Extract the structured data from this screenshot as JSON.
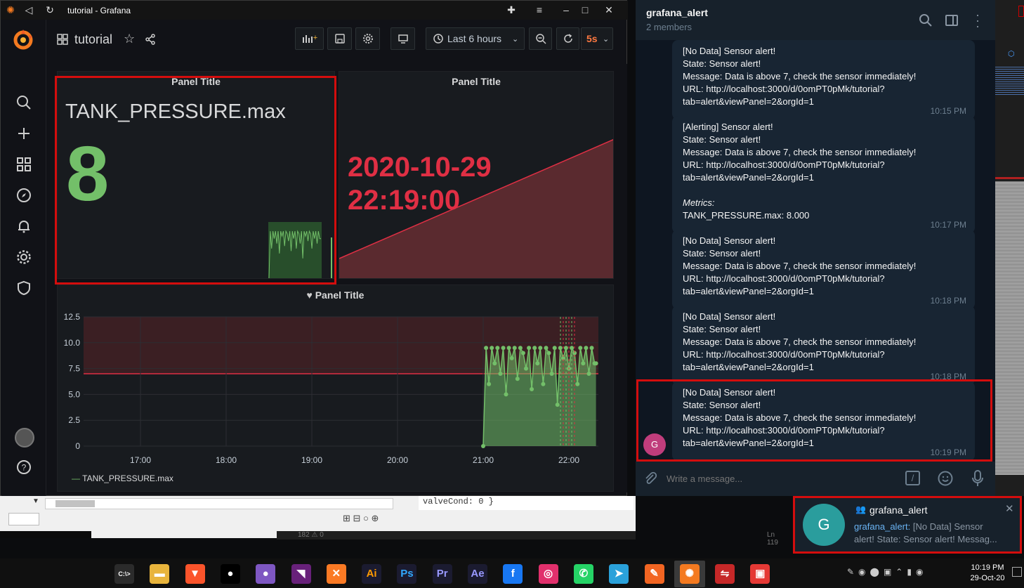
{
  "grafana_window": {
    "title": "tutorial - Grafana",
    "dashboard_name": "tutorial",
    "time_range": "Last 6 hours",
    "refresh": "5s"
  },
  "stat_panel": {
    "title": "Panel Title",
    "metric": "TANK_PRESSURE.max",
    "value": "8",
    "value_color": "#73bf69"
  },
  "time_panel": {
    "title": "Panel Title",
    "date": "2020-10-29",
    "time": "22:19:00",
    "color": "#e02f44"
  },
  "graph_panel": {
    "title": "Panel Title",
    "legend": "TANK_PRESSURE.max"
  },
  "chart_data": {
    "type": "line",
    "title": "Panel Title",
    "x_ticks": [
      "17:00",
      "18:00",
      "19:00",
      "20:00",
      "21:00",
      "22:00"
    ],
    "y_ticks": [
      "0",
      "2.5",
      "5.0",
      "7.5",
      "10.0",
      "12.5"
    ],
    "ylim": [
      0,
      12.5
    ],
    "threshold": 7,
    "series": [
      {
        "name": "TANK_PRESSURE.max",
        "color": "#73bf69",
        "x": [
          "21:00",
          "21:02",
          "21:04",
          "21:06",
          "21:08",
          "21:10",
          "21:12",
          "21:14",
          "21:16",
          "21:18",
          "21:20",
          "21:22",
          "21:24",
          "21:26",
          "21:28",
          "21:30",
          "21:32",
          "21:34",
          "21:36",
          "21:38",
          "21:40",
          "21:42",
          "21:44",
          "21:46",
          "21:48",
          "21:50",
          "21:52",
          "21:54",
          "21:56",
          "21:58",
          "22:00",
          "22:02",
          "22:04",
          "22:06",
          "22:08",
          "22:10",
          "22:12",
          "22:14",
          "22:16",
          "22:18",
          "22:19"
        ],
        "values": [
          0,
          9.5,
          6,
          9.5,
          8,
          9.5,
          7,
          9.5,
          5,
          9.5,
          8.5,
          9.5,
          6.5,
          9.5,
          9,
          7.5,
          9.5,
          5.5,
          9.5,
          8,
          9.5,
          6,
          9.5,
          9,
          7,
          9.5,
          4,
          9.5,
          8.5,
          9.5,
          7.5,
          9.5,
          9,
          6,
          9.5,
          8,
          9.5,
          7,
          9.5,
          8,
          8
        ]
      }
    ]
  },
  "telegram": {
    "chat_name": "grafana_alert",
    "members": "2 members",
    "avatar_letter": "G",
    "input_placeholder": "Write a message...",
    "messages": [
      {
        "lines": [
          "[No Data] Sensor alert!",
          "State: Sensor alert!",
          "Message: Data is above 7, check the sensor immediately!",
          "URL: http://localhost:3000/d/0omPT0pMk/tutorial?",
          "tab=alert&viewPanel=2&orgId=1"
        ],
        "time": "10:15 PM"
      },
      {
        "lines": [
          "[Alerting] Sensor alert!",
          "State: Sensor alert!",
          "Message: Data is above 7, check the sensor immediately!",
          "URL: http://localhost:3000/d/0omPT0pMk/tutorial?",
          "tab=alert&viewPanel=2&orgId=1",
          "",
          "Metrics:",
          "TANK_PRESSURE.max: 8.000"
        ],
        "time": "10:17 PM"
      },
      {
        "lines": [
          "[No Data] Sensor alert!",
          "State: Sensor alert!",
          "Message: Data is above 7, check the sensor immediately!",
          "URL: http://localhost:3000/d/0omPT0pMk/tutorial?",
          "tab=alert&viewPanel=2&orgId=1"
        ],
        "time": "10:18 PM"
      },
      {
        "lines": [
          "[No Data] Sensor alert!",
          "State: Sensor alert!",
          "Message: Data is above 7, check the sensor immediately!",
          "URL: http://localhost:3000/d/0omPT0pMk/tutorial?",
          "tab=alert&viewPanel=2&orgId=1"
        ],
        "time": "10:18 PM"
      },
      {
        "lines": [
          "[No Data] Sensor alert!",
          "State: Sensor alert!",
          "Message: Data is above 7, check the sensor immediately!",
          "URL: http://localhost:3000/d/0omPT0pMk/tutorial?",
          "tab=alert&viewPanel=2&orgId=1"
        ],
        "time": "10:19 PM"
      }
    ]
  },
  "notification": {
    "title": "grafana_alert",
    "sender": "grafana_alert:",
    "text_1": "[No Data] Sensor",
    "text_2": "alert! State: Sensor alert! Messag...",
    "avatar_letter": "G"
  },
  "editor": {
    "code": "valveCond: 0 }",
    "status": "Ln 119",
    "status2": "182 ⚠ 0"
  },
  "taskbar": {
    "time": "10:19 PM",
    "date": "29-Oct-20",
    "apps": [
      {
        "name": "terminal",
        "label": "C:\\>",
        "color": "#2b2b2b"
      },
      {
        "name": "file-explorer",
        "label": "▬",
        "color": "#e8b43c"
      },
      {
        "name": "brave",
        "label": "▼",
        "color": "#fb542b"
      },
      {
        "name": "github",
        "label": "●",
        "color": "#ffffff"
      },
      {
        "name": "github-desktop",
        "label": "●",
        "color": "#7e57c2"
      },
      {
        "name": "visual-studio",
        "label": "◥",
        "color": "#68217a"
      },
      {
        "name": "xampp",
        "label": "✕",
        "color": "#fb7a24"
      },
      {
        "name": "illustrator",
        "label": "Ai",
        "color": "#ff9a00"
      },
      {
        "name": "photoshop",
        "label": "Ps",
        "color": "#31a8ff"
      },
      {
        "name": "premiere",
        "label": "Pr",
        "color": "#9999ff"
      },
      {
        "name": "after-effects",
        "label": "Ae",
        "color": "#9999ff"
      },
      {
        "name": "facebook",
        "label": "f",
        "color": "#1877f2"
      },
      {
        "name": "instagram",
        "label": "◎",
        "color": "#e1306c"
      },
      {
        "name": "whatsapp",
        "label": "✆",
        "color": "#25d366"
      },
      {
        "name": "telegram",
        "label": "➤",
        "color": "#2aa1da"
      },
      {
        "name": "brush-app",
        "label": "✎",
        "color": "#f26522"
      },
      {
        "name": "grafana",
        "label": "✺",
        "color": "#f47a20"
      },
      {
        "name": "network-tool",
        "label": "⇋",
        "color": "#c62828"
      },
      {
        "name": "cube-app",
        "label": "▣",
        "color": "#e53935"
      }
    ]
  }
}
